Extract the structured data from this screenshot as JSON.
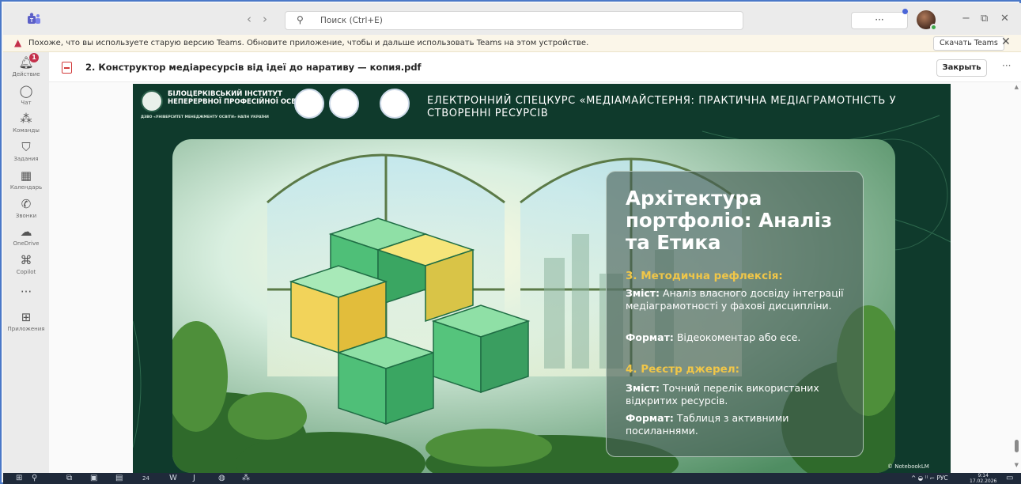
{
  "titlebar": {
    "search_placeholder": "Поиск (Ctrl+E)",
    "more": "···"
  },
  "banner": {
    "message": "Похоже, что вы используете старую версию Teams. Обновите приложение, чтобы и дальше использовать Teams на этом устройстве.",
    "download_button": "Скачать Teams"
  },
  "rail": {
    "items": [
      {
        "label": "Действие",
        "icon": "bell-icon",
        "badge": "1"
      },
      {
        "label": "Чат",
        "icon": "chat-icon"
      },
      {
        "label": "Команды",
        "icon": "teams-icon"
      },
      {
        "label": "Задания",
        "icon": "assignments-icon"
      },
      {
        "label": "Календарь",
        "icon": "calendar-icon"
      },
      {
        "label": "Звонки",
        "icon": "phone-icon"
      },
      {
        "label": "OneDrive",
        "icon": "cloud-icon"
      },
      {
        "label": "Copilot",
        "icon": "copilot-icon"
      },
      {
        "label": "···",
        "icon": "more-icon"
      },
      {
        "label": "Приложения",
        "icon": "apps-icon"
      }
    ]
  },
  "document": {
    "title": "2. Конструктор медіаресурсів від ідеї до наративу — копия.pdf",
    "close_button": "Закрыть"
  },
  "slide": {
    "institute_name_line1": "БІЛОЦЕРКІВСЬКИЙ ІНСТИТУТ",
    "institute_name_line2": "НЕПЕРЕРВНОЇ ПРОФЕСІЙНОЇ ОСВІТИ",
    "institute_sub": "ДЗВО «УНІВЕРСИТЕТ МЕНЕДЖМЕНТУ ОСВІТИ» НАПН УКРАЇНИ",
    "course_title": "ЕЛЕКТРОННИЙ СПЕЦКУРС «МЕДІАМАЙСТЕРНЯ: ПРАКТИЧНА МЕДІАГРАМОТНІСТЬ У СТВОРЕННІ РЕСУРСІВ",
    "card_title": "Архітектура портфоліо: Аналіз та Етика",
    "section3_heading": "3. Методична рефлексія:",
    "section3_content_label": "Зміст:",
    "section3_content": "Аналіз власного досвіду інтеграції медіаграмотності у фахові дисципліни.",
    "section3_format_label": "Формат:",
    "section3_format": "Відеокоментар або есе.",
    "section4_heading": "4. Реєстр джерел:",
    "section4_content_label": "Зміст:",
    "section4_content": "Точний перелік використаних відкритих ресурсів.",
    "section4_format_label": "Формат:",
    "section4_format": "Таблиця з активними посиланнями.",
    "watermark": "© NotebookLM"
  },
  "taskbar": {
    "weather_badge": "24",
    "language": "РУС",
    "time": "9:14",
    "date": "17.02.2026"
  },
  "colors": {
    "accent": "#4a66d8",
    "slide_bg": "#0f3a2c",
    "section_heading": "#f0c648",
    "alert": "#c4314b"
  }
}
